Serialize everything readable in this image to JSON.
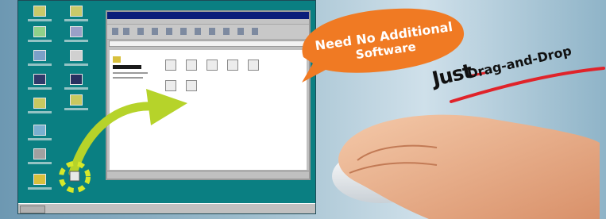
{
  "callout": {
    "line1": "Need No Additional",
    "line2": "Software",
    "color": "#f07a23"
  },
  "tagline": {
    "just": "Just",
    "drag_and_drop": "Drag-and-Drop"
  },
  "accents": {
    "arrow_color": "#b6d32a",
    "stroke_color": "#e0232a",
    "desktop_color": "#0a7f82"
  }
}
